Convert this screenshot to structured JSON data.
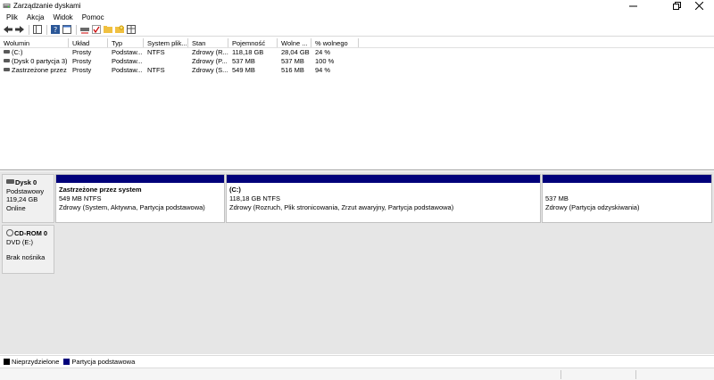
{
  "window": {
    "title": "Zarządzanie dyskami"
  },
  "menu": [
    "Plik",
    "Akcja",
    "Widok",
    "Pomoc"
  ],
  "toolbar": {
    "icons": [
      "back-arrow-icon",
      "forward-arrow-icon",
      "console-tree-icon",
      "help-icon",
      "properties-icon",
      "disk-icon",
      "check-icon",
      "folder-icon",
      "folder-star-icon",
      "view-icon"
    ]
  },
  "volumes": {
    "headers": [
      "Wolumin",
      "Układ",
      "Typ",
      "System plik...",
      "Stan",
      "Pojemność",
      "Wolne ...",
      "% wolnego"
    ],
    "rows": [
      [
        "(C:)",
        "Prosty",
        "Podstaw...",
        "NTFS",
        "Zdrowy (R...",
        "118,18 GB",
        "28,04 GB",
        "24 %"
      ],
      [
        "(Dysk 0 partycja 3)",
        "Prosty",
        "Podstaw...",
        "",
        "Zdrowy (P...",
        "537 MB",
        "537 MB",
        "100 %"
      ],
      [
        "Zastrzeżone przez ...",
        "Prosty",
        "Podstaw...",
        "NTFS",
        "Zdrowy (S...",
        "549 MB",
        "516 MB",
        "94 %"
      ]
    ]
  },
  "disks": [
    {
      "name": "Dysk 0",
      "type": "Podstawowy",
      "size": "119,24 GB",
      "status": "Online",
      "partitions": [
        {
          "name": "Zastrzeżone przez system",
          "size": "549 MB NTFS",
          "status": "Zdrowy (System, Aktywna, Partycja podstawowa)"
        },
        {
          "name": "(C:)",
          "size": "118,18 GB NTFS",
          "status": "Zdrowy (Rozruch, Plik stronicowania, Zrzut awaryjny, Partycja podstawowa)"
        },
        {
          "name": "",
          "size": "537 MB",
          "status": "Zdrowy (Partycja odzyskiwania)"
        }
      ]
    },
    {
      "name": "CD-ROM 0",
      "type": "DVD (E:)",
      "status": "Brak nośnika"
    }
  ],
  "legend": [
    {
      "label": "Nieprzydzielone",
      "color": "#000000"
    },
    {
      "label": "Partycja podstawowa",
      "color": "#00007a"
    }
  ]
}
